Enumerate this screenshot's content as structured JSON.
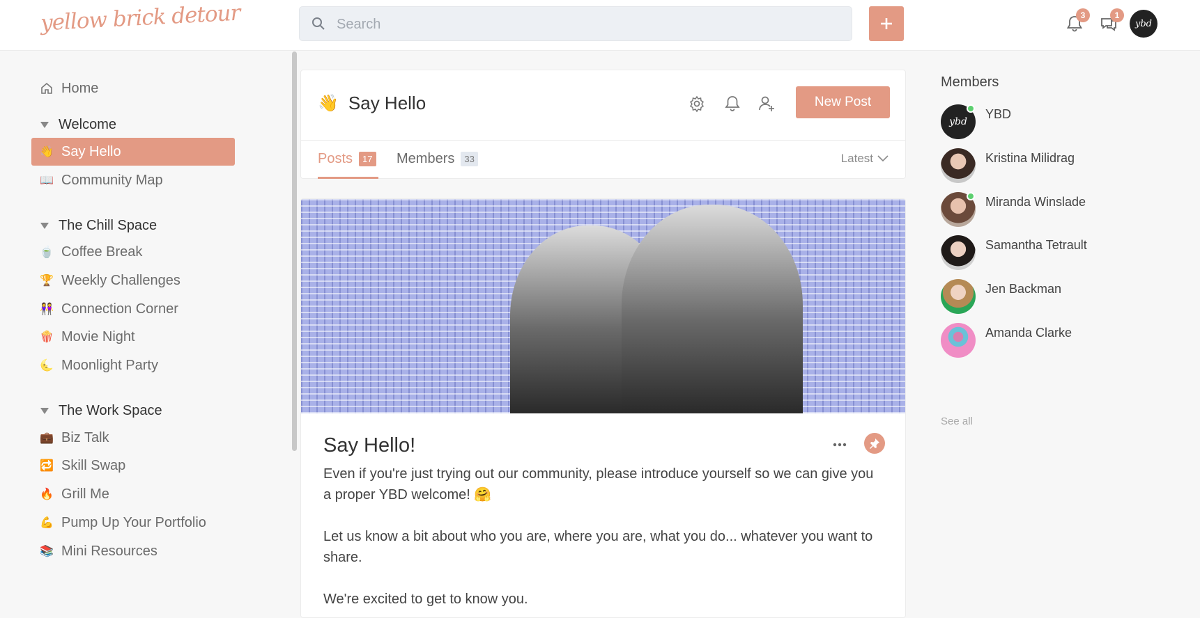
{
  "header": {
    "logo_text": "yellow brick detour",
    "search_placeholder": "Search",
    "notifications_badge": "3",
    "messages_badge": "1",
    "avatar_text": "ybd"
  },
  "nav": {
    "home": "Home",
    "groups": [
      {
        "label": "Welcome",
        "items": [
          {
            "label": "Say Hello",
            "emoji": "👋",
            "active": true
          },
          {
            "label": "Community Map",
            "emoji": "📖"
          }
        ]
      },
      {
        "label": "The Chill Space",
        "items": [
          {
            "label": "Coffee Break",
            "emoji": "🍵"
          },
          {
            "label": "Weekly Challenges",
            "emoji": "🏆"
          },
          {
            "label": "Connection Corner",
            "emoji": "👭"
          },
          {
            "label": "Movie Night",
            "emoji": "🍿"
          },
          {
            "label": "Moonlight Party",
            "emoji": "🌜"
          }
        ]
      },
      {
        "label": "The Work Space",
        "items": [
          {
            "label": "Biz Talk",
            "emoji": "💼"
          },
          {
            "label": "Skill Swap",
            "emoji": "🔁"
          },
          {
            "label": "Grill Me",
            "emoji": "🔥"
          },
          {
            "label": "Pump Up Your Portfolio",
            "emoji": "💪"
          },
          {
            "label": "Mini Resources",
            "emoji": "📚"
          }
        ]
      }
    ]
  },
  "space": {
    "emoji": "👋",
    "title": "Say Hello",
    "new_post_label": "New Post",
    "tabs": [
      {
        "label": "Posts",
        "count": "17"
      },
      {
        "label": "Members",
        "count": "33"
      }
    ],
    "sort_label": "Latest"
  },
  "post": {
    "title": "Say Hello!",
    "paragraphs": [
      "Even if you're just trying out our community, please introduce yourself so we can give you a proper YBD welcome! 🤗",
      "Let us know a bit about who you are, where you are, what you do... whatever you want to share.",
      "We're excited to get to know you."
    ]
  },
  "members": {
    "title": "Members",
    "list": [
      {
        "name": "YBD",
        "online": true
      },
      {
        "name": "Kristina Milidrag",
        "online": false
      },
      {
        "name": "Miranda Winslade",
        "online": true
      },
      {
        "name": "Samantha Tetrault",
        "online": false
      },
      {
        "name": "Jen Backman",
        "online": false
      },
      {
        "name": "Amanda Clarke",
        "online": false
      }
    ],
    "see_all": "See all"
  },
  "colors": {
    "accent": "#e39a84",
    "online": "#5ccf6f"
  }
}
